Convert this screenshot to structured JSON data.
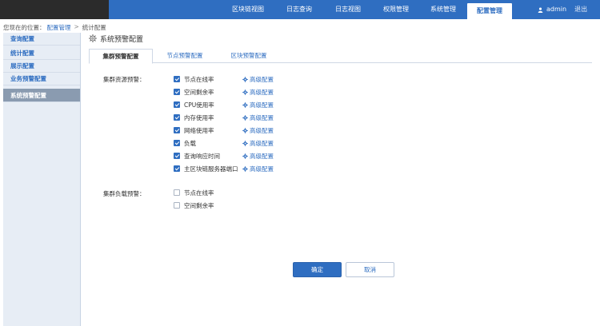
{
  "nav": {
    "items": [
      "区块链视图",
      "日志查询",
      "日志视图",
      "权限管理",
      "系统管理",
      "配置管理"
    ],
    "active_index": 5
  },
  "user": {
    "name": "admin",
    "logout": "退出"
  },
  "breadcrumb": {
    "prefix": "您现在的位置：",
    "level1": "配置管理",
    "sep": ">",
    "level2": "统计配置"
  },
  "sidebar": {
    "items": [
      "查询配置",
      "统计配置",
      "展示配置",
      "业务预警配置",
      "系统预警配置"
    ],
    "active_index": 4
  },
  "page": {
    "title": "系统预警配置"
  },
  "tabs": {
    "items": [
      "集群预警配置",
      "节点预警配置",
      "区块预警配置"
    ],
    "active_index": 0
  },
  "cluster_resource": {
    "label": "集群资源预警：",
    "advanced_label": "高级配置",
    "items": [
      {
        "label": "节点在线率",
        "checked": true
      },
      {
        "label": "空间剩余率",
        "checked": true
      },
      {
        "label": "CPU使用率",
        "checked": true
      },
      {
        "label": "内存使用率",
        "checked": true
      },
      {
        "label": "网络使用率",
        "checked": true
      },
      {
        "label": "负载",
        "checked": true
      },
      {
        "label": "查询响应时间",
        "checked": true
      },
      {
        "label": "主区块链服务器端口",
        "checked": true
      }
    ]
  },
  "cluster_load": {
    "label": "集群负载预警：",
    "items": [
      {
        "label": "节点在线率",
        "checked": false
      },
      {
        "label": "空间剩余率",
        "checked": false
      }
    ]
  },
  "buttons": {
    "confirm": "确定",
    "cancel": "取消"
  },
  "colors": {
    "primary": "#2f6ec1",
    "sidebar_bg": "#e7edf5",
    "sidebar_active": "#8a9bb0",
    "topbar_dark": "#2b2b2b"
  }
}
